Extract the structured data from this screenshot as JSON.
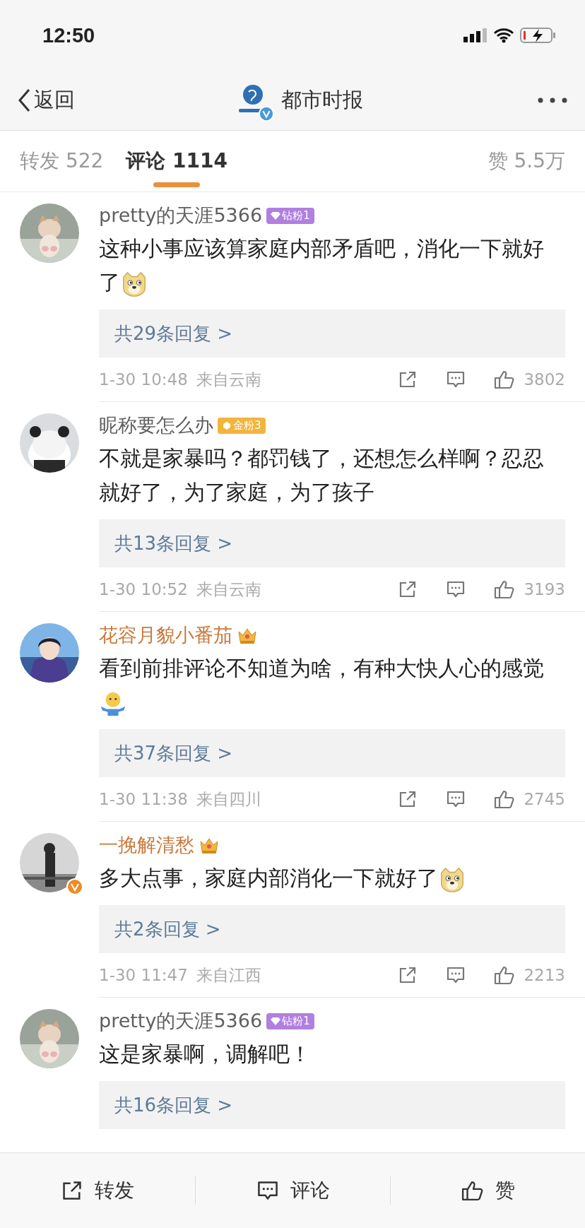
{
  "status_bar": {
    "time": "12:50"
  },
  "nav": {
    "back": "返回",
    "title": "都市时报",
    "verified": true
  },
  "tabs": [
    {
      "label": "转发 522",
      "selected": false
    },
    {
      "label": "评论 1114",
      "selected": true
    }
  ],
  "likes_total": "赞 5.5万",
  "comments": [
    {
      "user": "pretty的天涯5366",
      "vip": false,
      "badge": {
        "kind": "diamond",
        "label": "钻粉1"
      },
      "verified": false,
      "text": "这种小事应该算家庭内部矛盾吧，消化一下就好了",
      "emoji": {
        "kind": "doge"
      },
      "replies": "共29条回复 >",
      "time": "1-30 10:48",
      "source": "来自云南",
      "likes": "3802"
    },
    {
      "user": "昵称要怎么办",
      "vip": false,
      "badge": {
        "kind": "gold",
        "label": "金粉3"
      },
      "verified": false,
      "text": "不就是家暴吗？都罚钱了，还想怎么样啊？忍忍就好了，为了家庭，为了孩子",
      "replies": "共13条回复 >",
      "time": "1-30 10:52",
      "source": "来自云南",
      "likes": "3193"
    },
    {
      "user": "花容月貌小番茄",
      "vip": true,
      "badge": {
        "kind": "crown"
      },
      "verified": false,
      "text": "看到前排评论不知道为啥，有种大快人心的感觉",
      "emoji": {
        "kind": "shrug"
      },
      "replies": "共37条回复 >",
      "time": "1-30 11:38",
      "source": "来自四川",
      "likes": "2745"
    },
    {
      "user": "一挽解清愁",
      "vip": true,
      "badge": {
        "kind": "crown"
      },
      "verified": true,
      "text": "多大点事，家庭内部消化一下就好了",
      "emoji": {
        "kind": "doge"
      },
      "replies": "共2条回复 >",
      "time": "1-30 11:47",
      "source": "来自江西",
      "likes": "2213"
    },
    {
      "user": "pretty的天涯5366",
      "vip": false,
      "badge": {
        "kind": "diamond",
        "label": "钻粉1"
      },
      "verified": false,
      "text": "这是家暴啊，调解吧！",
      "replies": "共16条回复 >"
    }
  ],
  "bottom_bar": [
    {
      "kind": "repost",
      "label": "转发"
    },
    {
      "kind": "comment",
      "label": "评论"
    },
    {
      "kind": "like",
      "label": "赞"
    }
  ]
}
